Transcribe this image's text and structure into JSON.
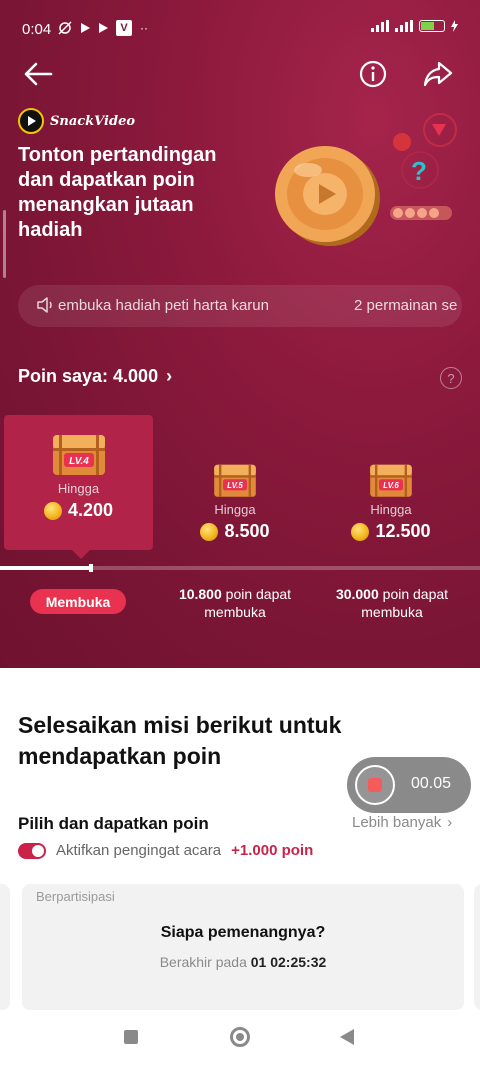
{
  "status_bar": {
    "time": "0:04",
    "battery_color": "#7fd04a"
  },
  "header": {
    "back_icon": "arrow-left-icon",
    "info_icon": "info-circle-icon",
    "share_icon": "share-arrow-icon"
  },
  "brand": {
    "name": "SnackVideo"
  },
  "hero": {
    "headline": "Tonton pertandingan dan dapatkan poin menangkan jutaan hadiah",
    "marquee_text_1": "embuka hadiah peti harta karun",
    "marquee_text_2": "2 permainan se"
  },
  "points": {
    "label": "Poin saya: 4.000",
    "chevron": "›",
    "help": "?"
  },
  "levels": [
    {
      "badge": "LV.4",
      "hingga": "Hingga",
      "prize": "4.200",
      "active": true
    },
    {
      "badge": "LV.5",
      "hingga": "Hingga",
      "prize": "8.500",
      "active": false
    },
    {
      "badge": "LV.6",
      "hingga": "Hingga",
      "prize": "12.500",
      "active": false
    }
  ],
  "progress": {
    "fraction": 0.19
  },
  "unlocks": {
    "open_label": "Membuka",
    "level5_points": "10.800",
    "level5_suffix": " poin dapat membuka",
    "level6_points": "30.000",
    "level6_suffix": " poin dapat membuka"
  },
  "missions": {
    "title": "Selesaikan misi berikut untuk mendapatkan poin",
    "section_title": "Pilih dan dapatkan poin",
    "more_label": "Lebih banyak",
    "more_chevron": "›",
    "reminder_label": "Aktifkan pengingat acara",
    "reminder_bonus": "+1.000 poin"
  },
  "recording": {
    "time": "00.05"
  },
  "event_card": {
    "tag": "Berpartisipasi",
    "question": "Siapa pemenangnya?",
    "ends_label": "Berakhir pada",
    "ends_value": "01 02:25:32"
  },
  "colors": {
    "accent": "#c9234a",
    "pill": "#e8324f",
    "hero_bg": "#7a1535"
  }
}
